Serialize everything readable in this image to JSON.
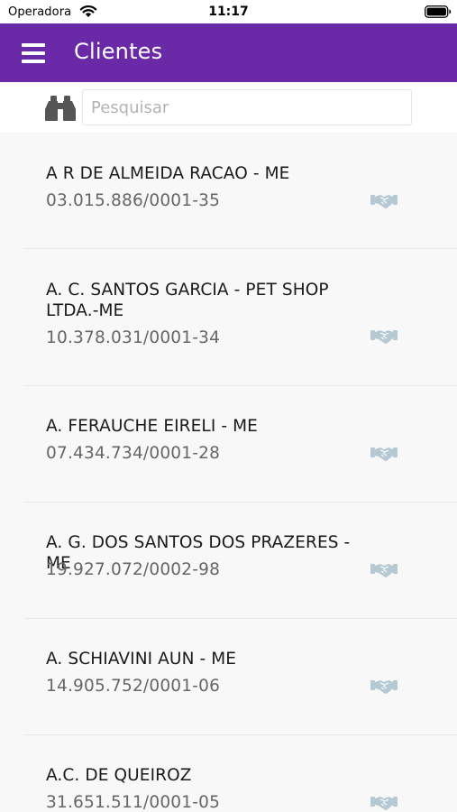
{
  "status_bar": {
    "carrier": "Operadora",
    "time": "11:17"
  },
  "header": {
    "title": "Clientes",
    "menu_icon": "hamburger-icon"
  },
  "search": {
    "placeholder": "Pesquisar",
    "value": "",
    "icon": "binoculars-icon"
  },
  "clients": [
    {
      "name": "A R DE ALMEIDA RACAO - ME",
      "cnpj": "03.015.886/0001-35"
    },
    {
      "name": "A. C. SANTOS GARCIA - PET SHOP LTDA.-ME",
      "cnpj": "10.378.031/0001-34"
    },
    {
      "name": "A. FERAUCHE EIRELI - ME",
      "cnpj": "07.434.734/0001-28"
    },
    {
      "name": "A. G. DOS SANTOS DOS PRAZERES - ME",
      "cnpj": "19.927.072/0002-98"
    },
    {
      "name": "A. SCHIAVINI AUN - ME",
      "cnpj": "14.905.752/0001-06"
    },
    {
      "name": "A.C. DE QUEIROZ",
      "cnpj": "31.651.511/0001-05"
    }
  ],
  "colors": {
    "appbar": "#6a2aa8",
    "row_icon": "#b5c9d3",
    "list_bg": "#f8f8f8"
  }
}
